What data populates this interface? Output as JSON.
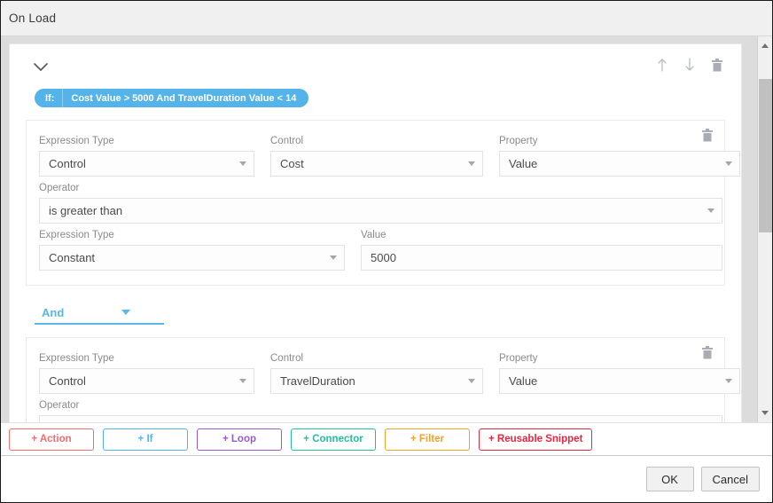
{
  "window": {
    "title": "On Load"
  },
  "header": {
    "collapse_icon": "chevron-down-icon",
    "move_up_icon": "arrow-up-icon",
    "move_down_icon": "arrow-down-icon",
    "delete_icon": "trash-icon"
  },
  "if_pill": {
    "key": "If:",
    "expression": "Cost Value > 5000 And TravelDuration Value < 14",
    "color": "#54b3e8"
  },
  "condition_groups": [
    {
      "delete_icon": "trash-icon",
      "fields": [
        {
          "label": "Expression Type",
          "value": "Control",
          "type": "select"
        },
        {
          "label": "Control",
          "value": "Cost",
          "type": "select"
        },
        {
          "label": "Property",
          "value": "Value",
          "type": "select"
        }
      ],
      "operator": {
        "label": "Operator",
        "value": "is greater than",
        "type": "select"
      },
      "operand": [
        {
          "label": "Expression Type",
          "value": "Constant",
          "type": "select"
        },
        {
          "label": "Value",
          "value": "5000",
          "type": "input"
        }
      ]
    },
    {
      "delete_icon": "trash-icon",
      "fields": [
        {
          "label": "Expression Type",
          "value": "Control",
          "type": "select"
        },
        {
          "label": "Control",
          "value": "TravelDuration",
          "type": "select"
        },
        {
          "label": "Property",
          "value": "Value",
          "type": "select"
        }
      ],
      "operator": {
        "label": "Operator",
        "value": "",
        "type": "select"
      }
    }
  ],
  "logic_connector": {
    "label": "And",
    "color": "#5bb7e8"
  },
  "add_buttons": [
    {
      "label": "+ Action",
      "color": "#f26d6d"
    },
    {
      "label": "+ If",
      "color": "#56b4e9"
    },
    {
      "label": "+ Loop",
      "color": "#9b59d0"
    },
    {
      "label": "+ Connector",
      "color": "#21bfa0"
    },
    {
      "label": "+ Filter",
      "color": "#eda32c"
    },
    {
      "label": "+ Reusable Snippet",
      "color": "#e3283f"
    }
  ],
  "footer": {
    "ok_label": "OK",
    "cancel_label": "Cancel"
  },
  "scrollbar": {
    "up_icon": "scroll-up-icon",
    "down_icon": "scroll-down-icon"
  }
}
